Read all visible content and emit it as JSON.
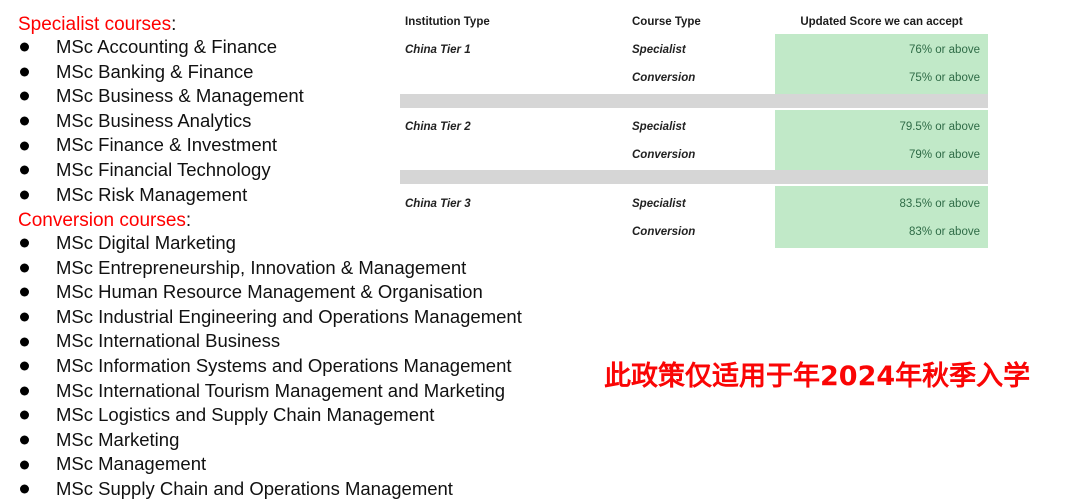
{
  "specialist": {
    "heading": "Specialist courses",
    "colon": ":",
    "items": [
      "MSc Accounting & Finance",
      "MSc Banking & Finance",
      "MSc Business & Management",
      "MSc Business Analytics",
      "MSc Finance & Investment",
      "MSc Financial Technology",
      "MSc Risk Management"
    ]
  },
  "conversion": {
    "heading": "Conversion courses",
    "colon": ":",
    "items": [
      "MSc Digital Marketing",
      "MSc Entrepreneurship, Innovation & Management",
      "MSc Human Resource Management & Organisation",
      "MSc Industrial Engineering and Operations Management",
      "MSc International Business",
      "MSc Information Systems and Operations Management",
      "MSc International Tourism Management and Marketing",
      "MSc Logistics and Supply Chain Management",
      "MSc Marketing",
      "MSc Management",
      "MSc Supply Chain and Operations Management"
    ]
  },
  "table": {
    "headers": {
      "institution": "Institution Type",
      "course": "Course Type",
      "score": "Updated Score we can accept"
    },
    "rows": [
      {
        "institution": "China Tier 1",
        "course": "Specialist",
        "score": "76% or above"
      },
      {
        "institution": "",
        "course": "Conversion",
        "score": "75% or above"
      },
      {
        "institution": "China Tier 2",
        "course": "Specialist",
        "score": "79.5% or above"
      },
      {
        "institution": "",
        "course": "Conversion",
        "score": "79% or above"
      },
      {
        "institution": "China Tier 3",
        "course": "Specialist",
        "score": "83.5% or above"
      },
      {
        "institution": "",
        "course": "Conversion",
        "score": "83% or above"
      }
    ]
  },
  "note": {
    "text": "此政策仅适用于年2024年秋季入学"
  },
  "colors": {
    "heading_red": "#ff0000",
    "note_red": "#fa0505",
    "score_green_bg": "#c1e9c8",
    "score_green_text": "#2e6b46",
    "separator_grey": "#d6d6d6"
  }
}
